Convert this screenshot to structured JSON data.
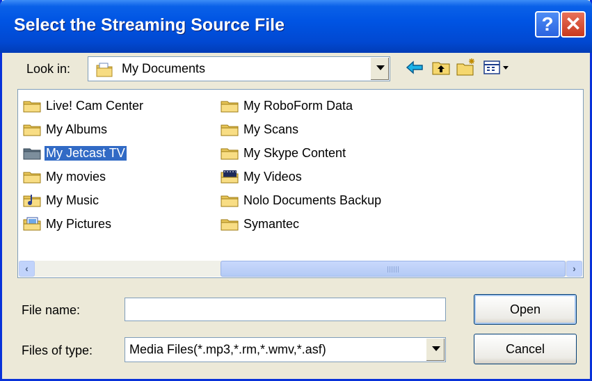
{
  "window": {
    "title": "Select the Streaming Source File",
    "help_label": "?",
    "close_label": "✕"
  },
  "lookin": {
    "label": "Look in:",
    "value": "My Documents",
    "icon": "documents-folder-icon"
  },
  "toolbar": {
    "back": "back-arrow-icon",
    "up": "up-folder-icon",
    "new_folder": "new-folder-icon",
    "views": "views-menu-icon"
  },
  "files": [
    {
      "name": "Live! Cam Center",
      "icon": "folder-icon"
    },
    {
      "name": "My Albums",
      "icon": "folder-icon"
    },
    {
      "name": "My Jetcast TV",
      "icon": "folder-icon",
      "selected": true
    },
    {
      "name": "My movies",
      "icon": "folder-icon"
    },
    {
      "name": "My Music",
      "icon": "music-folder-icon"
    },
    {
      "name": "My Pictures",
      "icon": "pictures-folder-icon"
    },
    {
      "name": "My RoboForm Data",
      "icon": "folder-icon"
    },
    {
      "name": "My Scans",
      "icon": "folder-icon"
    },
    {
      "name": "My Skype Content",
      "icon": "folder-icon"
    },
    {
      "name": "My Videos",
      "icon": "video-folder-icon"
    },
    {
      "name": "Nolo Documents Backup",
      "icon": "folder-icon"
    },
    {
      "name": "Symantec",
      "icon": "folder-icon"
    }
  ],
  "filename": {
    "label": "File name:",
    "value": ""
  },
  "filetype": {
    "label": "Files of type:",
    "value": "Media Files(*.mp3,*.rm,*.wmv,*.asf)"
  },
  "buttons": {
    "open": "Open",
    "cancel": "Cancel"
  },
  "colors": {
    "titlebar": "#0054E3",
    "selection": "#316AC5",
    "dialog_bg": "#ECE9D8"
  }
}
